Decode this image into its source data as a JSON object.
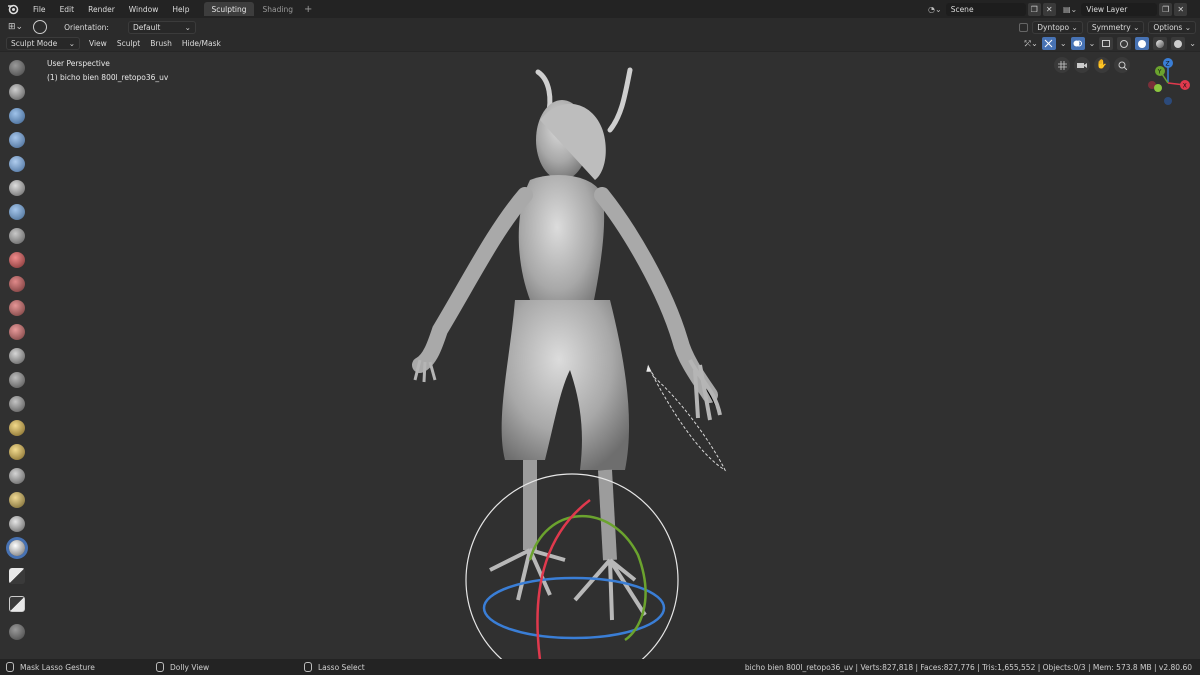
{
  "topbar": {
    "menu": [
      "File",
      "Edit",
      "Render",
      "Window",
      "Help"
    ],
    "tabs": [
      {
        "label": "Sculpting",
        "active": true
      },
      {
        "label": "Shading",
        "active": false
      }
    ],
    "add_tab": "+",
    "scene": "Scene",
    "view_layer": "View Layer"
  },
  "header": {
    "orientation_label": "Orientation:",
    "orientation_value": "Default",
    "dyntopo": "Dyntopo",
    "symmetry": "Symmetry",
    "options": "Options"
  },
  "header2": {
    "mode": "Sculpt Mode",
    "menus": [
      "View",
      "Sculpt",
      "Brush",
      "Hide/Mask"
    ]
  },
  "viewport": {
    "perspective": "User Perspective",
    "object": "(1) bicho bien 800l_retopo36_uv",
    "gizmo_labels": {
      "x": "X",
      "y": "Y",
      "z": "Z"
    }
  },
  "toolbar_icons": [
    "draw-brush",
    "clay-brush",
    "clay-strips-brush",
    "layer-brush",
    "inflate-brush",
    "blob-brush",
    "crease-brush",
    "smooth-brush",
    "flatten-brush",
    "fill-brush",
    "scrape-brush",
    "pinch-brush",
    "grab-brush",
    "snake-hook-brush",
    "thumb-brush",
    "nudge-brush",
    "rotate-brush",
    "mask-brush",
    "simplify-brush",
    "box-mask-tool",
    "lasso-mask-tool",
    "box-hide-tool",
    "transform-tool",
    "annotate-tool"
  ],
  "status": {
    "left": "Mask Lasso Gesture",
    "middle": "Dolly View",
    "right_action": "Lasso Select",
    "stats": "bicho bien 800l_retopo36_uv | Verts:827,818 | Faces:827,776 | Tris:1,655,552 | Objects:0/3 | Mem: 573.8 MB | v2.80.60"
  },
  "colors": {
    "accent": "#4772b3",
    "gizmo_x": "#e0394d",
    "gizmo_y": "#6ba32e",
    "gizmo_z": "#3a7ed6"
  }
}
